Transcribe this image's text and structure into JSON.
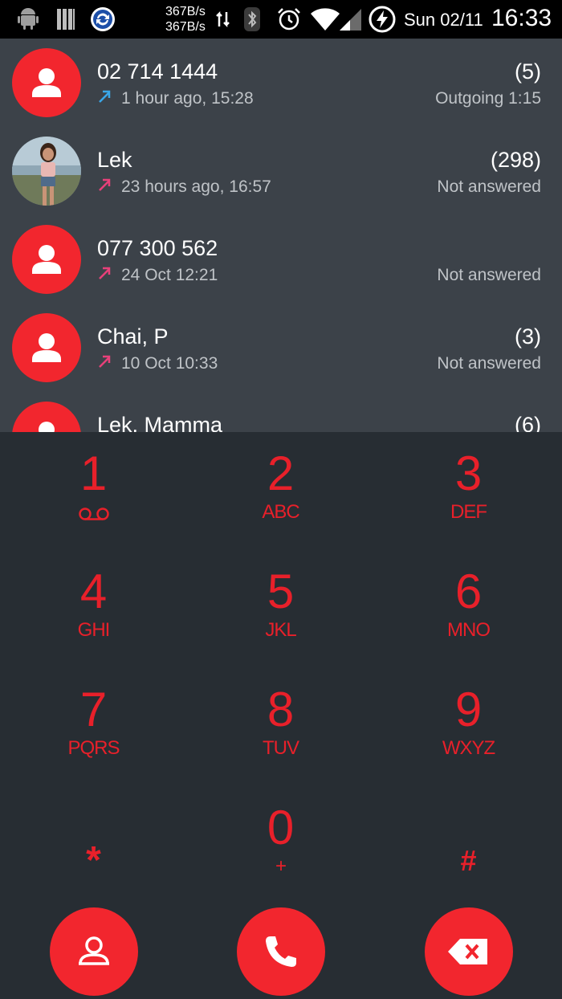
{
  "status_bar": {
    "speed_up": "367B/s",
    "speed_down": "367B/s",
    "date": "Sun 02/11",
    "time": "16:33",
    "icons": [
      "android-icon",
      "storage-icon",
      "sync-icon",
      "data-arrows-icon",
      "bluetooth-icon",
      "alarm-icon",
      "wifi-icon",
      "signal-icon",
      "battery-charging-icon"
    ]
  },
  "call_log": [
    {
      "name": "02 714 1444",
      "when": "1 hour ago, 15:28",
      "count": "(5)",
      "status": "Outgoing 1:15",
      "direction": "outgoing",
      "avatar": "default"
    },
    {
      "name": "Lek",
      "when": "23 hours ago, 16:57",
      "count": "(298)",
      "status": "Not answered",
      "direction": "missed-outgoing",
      "avatar": "photo"
    },
    {
      "name": "077 300 562",
      "when": "24 Oct 12:21",
      "count": "",
      "status": "Not answered",
      "direction": "missed-outgoing",
      "avatar": "default"
    },
    {
      "name": "Chai, P",
      "when": "10 Oct 10:33",
      "count": "(3)",
      "status": "Not answered",
      "direction": "missed-outgoing",
      "avatar": "default"
    },
    {
      "name": "Lek, Mamma",
      "when": "",
      "count": "(6)",
      "status": "",
      "direction": "",
      "avatar": "default"
    }
  ],
  "dialpad": {
    "keys": [
      {
        "digit": "1",
        "letters": "",
        "extra": "voicemail-icon"
      },
      {
        "digit": "2",
        "letters": "ABC"
      },
      {
        "digit": "3",
        "letters": "DEF"
      },
      {
        "digit": "4",
        "letters": "GHI"
      },
      {
        "digit": "5",
        "letters": "JKL"
      },
      {
        "digit": "6",
        "letters": "MNO"
      },
      {
        "digit": "7",
        "letters": "PQRS"
      },
      {
        "digit": "8",
        "letters": "TUV"
      },
      {
        "digit": "9",
        "letters": "WXYZ"
      },
      {
        "digit": "*",
        "letters": ""
      },
      {
        "digit": "0",
        "letters": "+"
      },
      {
        "digit": "#",
        "letters": ""
      }
    ]
  },
  "actions": [
    "contacts-icon",
    "call-icon",
    "backspace-icon"
  ],
  "colors": {
    "accent": "#f2262e",
    "dialpad_text": "#e8202a",
    "log_bg": "#3c4249",
    "dialpad_bg": "#272d33",
    "outgoing_arrow": "#3aa7e8",
    "missed_arrow": "#e8407a"
  }
}
